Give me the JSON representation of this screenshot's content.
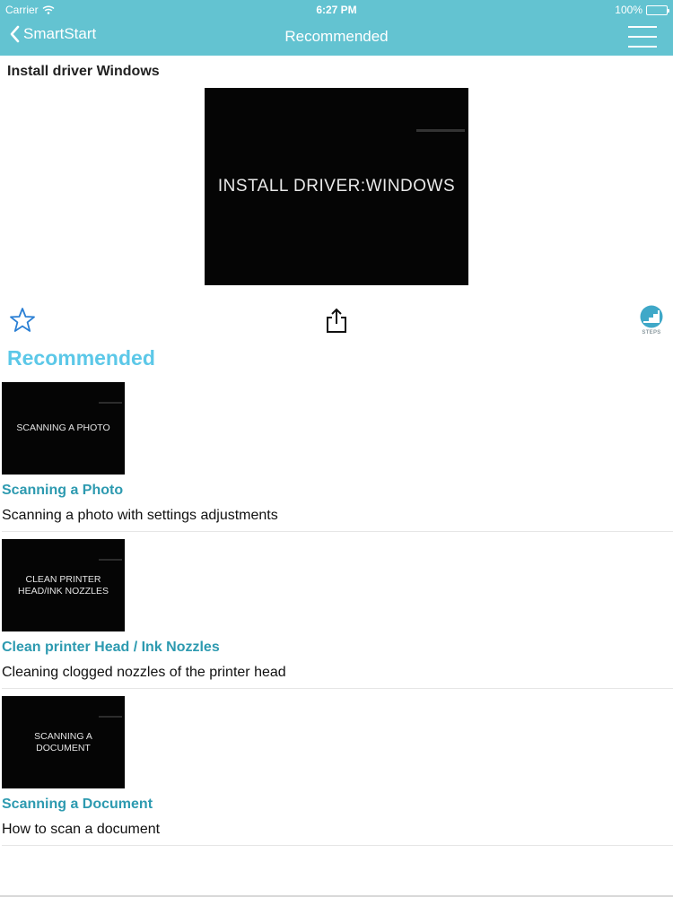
{
  "status_bar": {
    "carrier": "Carrier",
    "time": "6:27 PM",
    "battery": "100%"
  },
  "nav": {
    "back_label": "SmartStart",
    "title": "Recommended"
  },
  "feature": {
    "title": "Install driver Windows",
    "video_text": "INSTALL DRIVER:WINDOWS",
    "steps_label": "STEPS"
  },
  "recommended": {
    "heading": "Recommended",
    "items": [
      {
        "thumb_text": "SCANNING A PHOTO",
        "title": "Scanning a Photo",
        "description": "Scanning a photo with settings adjustments"
      },
      {
        "thumb_text": "CLEAN PRINTER HEAD/INK NOZZLES",
        "title": "Clean printer Head / Ink Nozzles",
        "description": "Cleaning clogged nozzles of the printer head"
      },
      {
        "thumb_text": "SCANNING A DOCUMENT",
        "title": "Scanning a Document",
        "description": "How to scan a document"
      }
    ]
  },
  "colors": {
    "nav_bar": "#63c3d1",
    "heading_accent": "#5cc8e8",
    "item_title": "#2d9ab0",
    "icon_blue": "#2a7fd4"
  },
  "icons": {
    "back": "chevron-left-icon",
    "menu": "hamburger-menu-icon",
    "favorite": "star-outline-icon",
    "share": "share-icon",
    "steps": "steps-logo-icon"
  }
}
